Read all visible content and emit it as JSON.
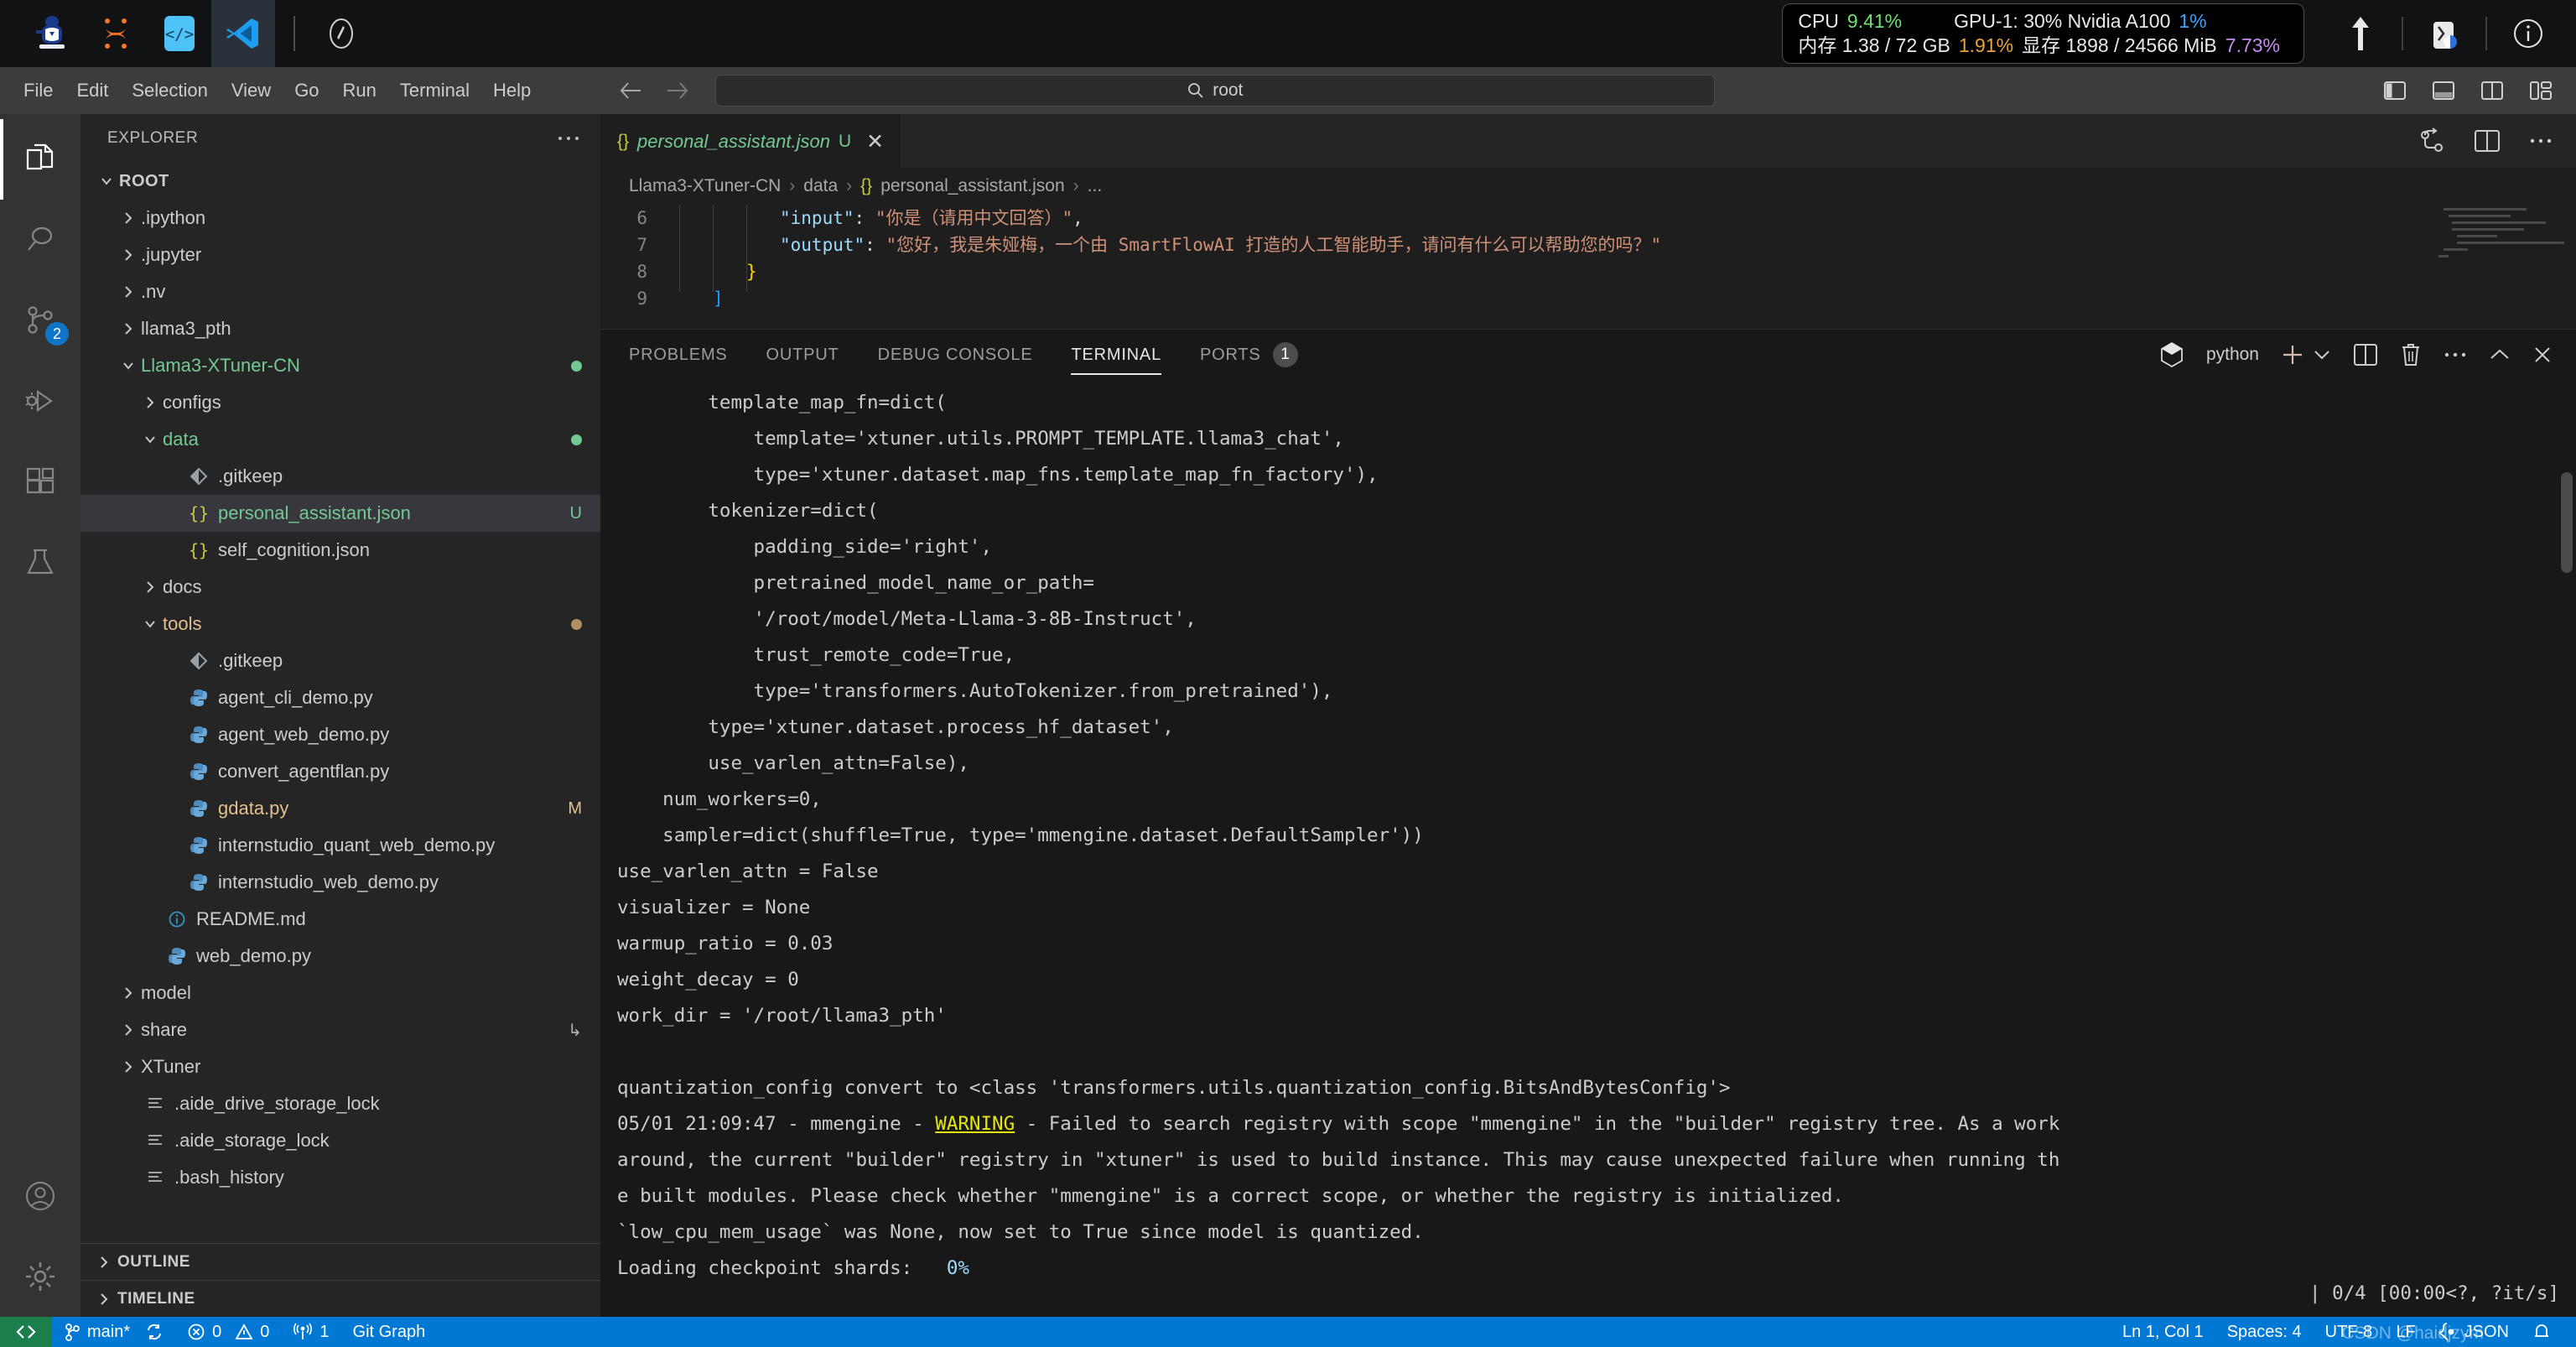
{
  "os_bar": {
    "apps": [
      {
        "name": "jupyterhub-icon",
        "label": "JupyterHub"
      },
      {
        "name": "jupyter-icon",
        "label": "Jupyter"
      },
      {
        "name": "code-server-icon",
        "label": "Code Server"
      },
      {
        "name": "vscode-icon",
        "label": "Visual Studio Code"
      }
    ],
    "compass_icon": "compass-icon",
    "stats": {
      "cpu_label": "CPU",
      "cpu_value": "9.41%",
      "gpu_label": "GPU-1: 30% Nvidia A100",
      "gpu_value": "1%",
      "mem_label": "内存 1.38 / 72 GB",
      "mem_value": "1.91%",
      "vram_label": "显存 1898 / 24566 MiB",
      "vram_value": "7.73%"
    },
    "right_icons": [
      "upload-icon",
      "network-icon",
      "info-icon"
    ]
  },
  "menubar": {
    "items": [
      "File",
      "Edit",
      "Selection",
      "View",
      "Go",
      "Run",
      "Terminal",
      "Help"
    ],
    "back_icon": "arrow-left-icon",
    "forward_icon": "arrow-right-icon"
  },
  "quick_search": {
    "icon": "search-icon",
    "value": "root"
  },
  "title_right_icons": [
    "toggle-primary-sidebar-icon",
    "toggle-panel-icon",
    "toggle-secondary-sidebar-icon",
    "customize-layout-icon"
  ],
  "activity_bar": {
    "items": [
      {
        "name": "explorer",
        "icon": "files-icon",
        "active": true,
        "badge": ""
      },
      {
        "name": "search",
        "icon": "search-icon",
        "active": false,
        "badge": ""
      },
      {
        "name": "source-control",
        "icon": "source-control-icon",
        "active": false,
        "badge": "2"
      },
      {
        "name": "run-and-debug",
        "icon": "debug-icon",
        "active": false,
        "badge": ""
      },
      {
        "name": "extensions",
        "icon": "extensions-icon",
        "active": false,
        "badge": ""
      },
      {
        "name": "testing",
        "icon": "beaker-icon",
        "active": false,
        "badge": ""
      }
    ],
    "bottom": [
      {
        "name": "accounts",
        "icon": "account-icon"
      },
      {
        "name": "manage",
        "icon": "gear-icon"
      }
    ]
  },
  "sidebar": {
    "header": "EXPLORER",
    "more_icon": "ellipsis-icon",
    "tree": [
      {
        "label": "ROOT",
        "indent": 0,
        "chev": "down",
        "icon": "",
        "bold": true,
        "color": "white",
        "deco": "",
        "dot": ""
      },
      {
        "label": ".ipython",
        "indent": 1,
        "chev": "right",
        "icon": "",
        "bold": false,
        "color": "white",
        "deco": "",
        "dot": ""
      },
      {
        "label": ".jupyter",
        "indent": 1,
        "chev": "right",
        "icon": "",
        "bold": false,
        "color": "white",
        "deco": "",
        "dot": ""
      },
      {
        "label": ".nv",
        "indent": 1,
        "chev": "right",
        "icon": "",
        "bold": false,
        "color": "white",
        "deco": "",
        "dot": ""
      },
      {
        "label": "llama3_pth",
        "indent": 1,
        "chev": "right",
        "icon": "",
        "bold": false,
        "color": "white",
        "deco": "",
        "dot": ""
      },
      {
        "label": "Llama3-XTuner-CN",
        "indent": 1,
        "chev": "down",
        "icon": "",
        "bold": false,
        "color": "green",
        "deco": "",
        "dot": "green"
      },
      {
        "label": "configs",
        "indent": 2,
        "chev": "right",
        "icon": "",
        "bold": false,
        "color": "white",
        "deco": "",
        "dot": ""
      },
      {
        "label": "data",
        "indent": 2,
        "chev": "down",
        "icon": "",
        "bold": false,
        "color": "green",
        "deco": "",
        "dot": "green"
      },
      {
        "label": ".gitkeep",
        "indent": 3,
        "chev": "none",
        "icon": "git",
        "bold": false,
        "color": "white",
        "deco": "",
        "dot": ""
      },
      {
        "label": "personal_assistant.json",
        "indent": 3,
        "chev": "none",
        "icon": "json",
        "bold": false,
        "color": "green",
        "deco": "U",
        "dot": "",
        "selected": true
      },
      {
        "label": "self_cognition.json",
        "indent": 3,
        "chev": "none",
        "icon": "json",
        "bold": false,
        "color": "white",
        "deco": "",
        "dot": ""
      },
      {
        "label": "docs",
        "indent": 2,
        "chev": "right",
        "icon": "",
        "bold": false,
        "color": "white",
        "deco": "",
        "dot": ""
      },
      {
        "label": "tools",
        "indent": 2,
        "chev": "down",
        "icon": "",
        "bold": false,
        "color": "orange",
        "deco": "",
        "dot": "orange"
      },
      {
        "label": ".gitkeep",
        "indent": 3,
        "chev": "none",
        "icon": "git",
        "bold": false,
        "color": "white",
        "deco": "",
        "dot": ""
      },
      {
        "label": "agent_cli_demo.py",
        "indent": 3,
        "chev": "none",
        "icon": "py",
        "bold": false,
        "color": "white",
        "deco": "",
        "dot": ""
      },
      {
        "label": "agent_web_demo.py",
        "indent": 3,
        "chev": "none",
        "icon": "py",
        "bold": false,
        "color": "white",
        "deco": "",
        "dot": ""
      },
      {
        "label": "convert_agentflan.py",
        "indent": 3,
        "chev": "none",
        "icon": "py",
        "bold": false,
        "color": "white",
        "deco": "",
        "dot": ""
      },
      {
        "label": "gdata.py",
        "indent": 3,
        "chev": "none",
        "icon": "py",
        "bold": false,
        "color": "orange",
        "deco": "M",
        "dot": ""
      },
      {
        "label": "internstudio_quant_web_demo.py",
        "indent": 3,
        "chev": "none",
        "icon": "py",
        "bold": false,
        "color": "white",
        "deco": "",
        "dot": ""
      },
      {
        "label": "internstudio_web_demo.py",
        "indent": 3,
        "chev": "none",
        "icon": "py",
        "bold": false,
        "color": "white",
        "deco": "",
        "dot": ""
      },
      {
        "label": "README.md",
        "indent": 2,
        "chev": "none",
        "icon": "info",
        "bold": false,
        "color": "white",
        "deco": "",
        "dot": ""
      },
      {
        "label": "web_demo.py",
        "indent": 2,
        "chev": "none",
        "icon": "py",
        "bold": false,
        "color": "white",
        "deco": "",
        "dot": ""
      },
      {
        "label": "model",
        "indent": 1,
        "chev": "right",
        "icon": "",
        "bold": false,
        "color": "white",
        "deco": "",
        "dot": ""
      },
      {
        "label": "share",
        "indent": 1,
        "chev": "right",
        "icon": "",
        "bold": false,
        "color": "white",
        "deco": "↳",
        "dot": ""
      },
      {
        "label": "XTuner",
        "indent": 1,
        "chev": "right",
        "icon": "",
        "bold": false,
        "color": "white",
        "deco": "",
        "dot": ""
      },
      {
        "label": ".aide_drive_storage_lock",
        "indent": 1,
        "chev": "none",
        "icon": "file",
        "bold": false,
        "color": "white",
        "deco": "",
        "dot": ""
      },
      {
        "label": ".aide_storage_lock",
        "indent": 1,
        "chev": "none",
        "icon": "file",
        "bold": false,
        "color": "white",
        "deco": "",
        "dot": ""
      },
      {
        "label": ".bash_history",
        "indent": 1,
        "chev": "none",
        "icon": "file",
        "bold": false,
        "color": "white",
        "deco": "",
        "dot": ""
      }
    ],
    "sections": [
      {
        "label": "OUTLINE",
        "chev": "right"
      },
      {
        "label": "TIMELINE",
        "chev": "right"
      }
    ]
  },
  "editor": {
    "tab": {
      "icon": "json-icon",
      "filename": "personal_assistant.json",
      "status": "U",
      "close_icon": "close-icon"
    },
    "tab_actions": [
      "split-editor-icon",
      "more-actions-icon"
    ],
    "breadcrumb": [
      "Llama3-XTuner-CN",
      "data",
      "personal_assistant.json",
      "..."
    ],
    "lines": [
      {
        "no": "6",
        "key": "\"input\"",
        "colon": ": ",
        "value": "\"你是（请用中文回答）\"",
        "tail": ","
      },
      {
        "no": "7",
        "key": "\"output\"",
        "colon": ": ",
        "value": "\"您好，我是朱娅梅，一个由 SmartFlowAI 打造的人工智能助手，请问有什么可以帮助您的吗？\"",
        "tail": ""
      },
      {
        "no": "8",
        "brace": "}"
      },
      {
        "no": "9",
        "bracket": "]"
      }
    ]
  },
  "panel": {
    "tabs": [
      {
        "label": "PROBLEMS",
        "active": false,
        "badge": ""
      },
      {
        "label": "OUTPUT",
        "active": false,
        "badge": ""
      },
      {
        "label": "DEBUG CONSOLE",
        "active": false,
        "badge": ""
      },
      {
        "label": "TERMINAL",
        "active": true,
        "badge": ""
      },
      {
        "label": "PORTS",
        "active": false,
        "badge": "1"
      }
    ],
    "shell_icon": "python-icon",
    "shell_label": "python",
    "actions": [
      "new-terminal-icon",
      "terminal-dropdown-icon",
      "split-terminal-icon",
      "kill-terminal-icon",
      "more-actions-icon",
      "maximize-panel-icon",
      "close-panel-icon"
    ],
    "terminal_lines": [
      "        template_map_fn=dict(",
      "            template='xtuner.utils.PROMPT_TEMPLATE.llama3_chat',",
      "            type='xtuner.dataset.map_fns.template_map_fn_factory'),",
      "        tokenizer=dict(",
      "            padding_side='right',",
      "            pretrained_model_name_or_path=",
      "            '/root/model/Meta-Llama-3-8B-Instruct',",
      "            trust_remote_code=True,",
      "            type='transformers.AutoTokenizer.from_pretrained'),",
      "        type='xtuner.dataset.process_hf_dataset',",
      "        use_varlen_attn=False),",
      "    num_workers=0,",
      "    sampler=dict(shuffle=True, type='mmengine.dataset.DefaultSampler'))",
      "use_varlen_attn = False",
      "visualizer = None",
      "warmup_ratio = 0.03",
      "weight_decay = 0",
      "work_dir = '/root/llama3_pth'",
      "",
      "quantization_config convert to <class 'transformers.utils.quantization_config.BitsAndBytesConfig'>"
    ],
    "warning_line": {
      "prefix": "05/01 21:09:47 - mmengine - ",
      "level": "WARNING",
      "suffix": " - Failed to search registry with scope \"mmengine\" in the \"builder\" registry tree. As a work"
    },
    "warning_cont": [
      "around, the current \"builder\" registry in \"xtuner\" is used to build instance. This may cause unexpected failure when running th",
      "e built modules. Please check whether \"mmengine\" is a correct scope, or whether the registry is initialized."
    ],
    "tail_lines": [
      "`low_cpu_mem_usage` was None, now set to True since model is quantized."
    ],
    "progress": {
      "label": "Loading checkpoint shards:",
      "percent": "0%",
      "right": "| 0/4 [00:00<?, ?it/s]"
    }
  },
  "status_bar": {
    "remote_icon": "remote-window-icon",
    "left": [
      {
        "icon": "source-control-icon",
        "label": "main*"
      },
      {
        "icon": "sync-icon",
        "label": ""
      },
      {
        "icon": "error-icon",
        "label": "0"
      },
      {
        "icon": "warning-icon",
        "label": "0"
      },
      {
        "icon": "radio-tower-icon",
        "label": "1"
      },
      {
        "icon": "",
        "label": "Git Graph"
      }
    ],
    "right": [
      {
        "label": "Ln 1, Col 1"
      },
      {
        "label": "Spaces: 4"
      },
      {
        "label": "UTF-8"
      },
      {
        "label": "LF"
      },
      {
        "label": "JSON",
        "icon": "json-icon"
      },
      {
        "label": "",
        "icon": "bell-icon"
      }
    ]
  },
  "watermark": "CSDN @haidjzym"
}
